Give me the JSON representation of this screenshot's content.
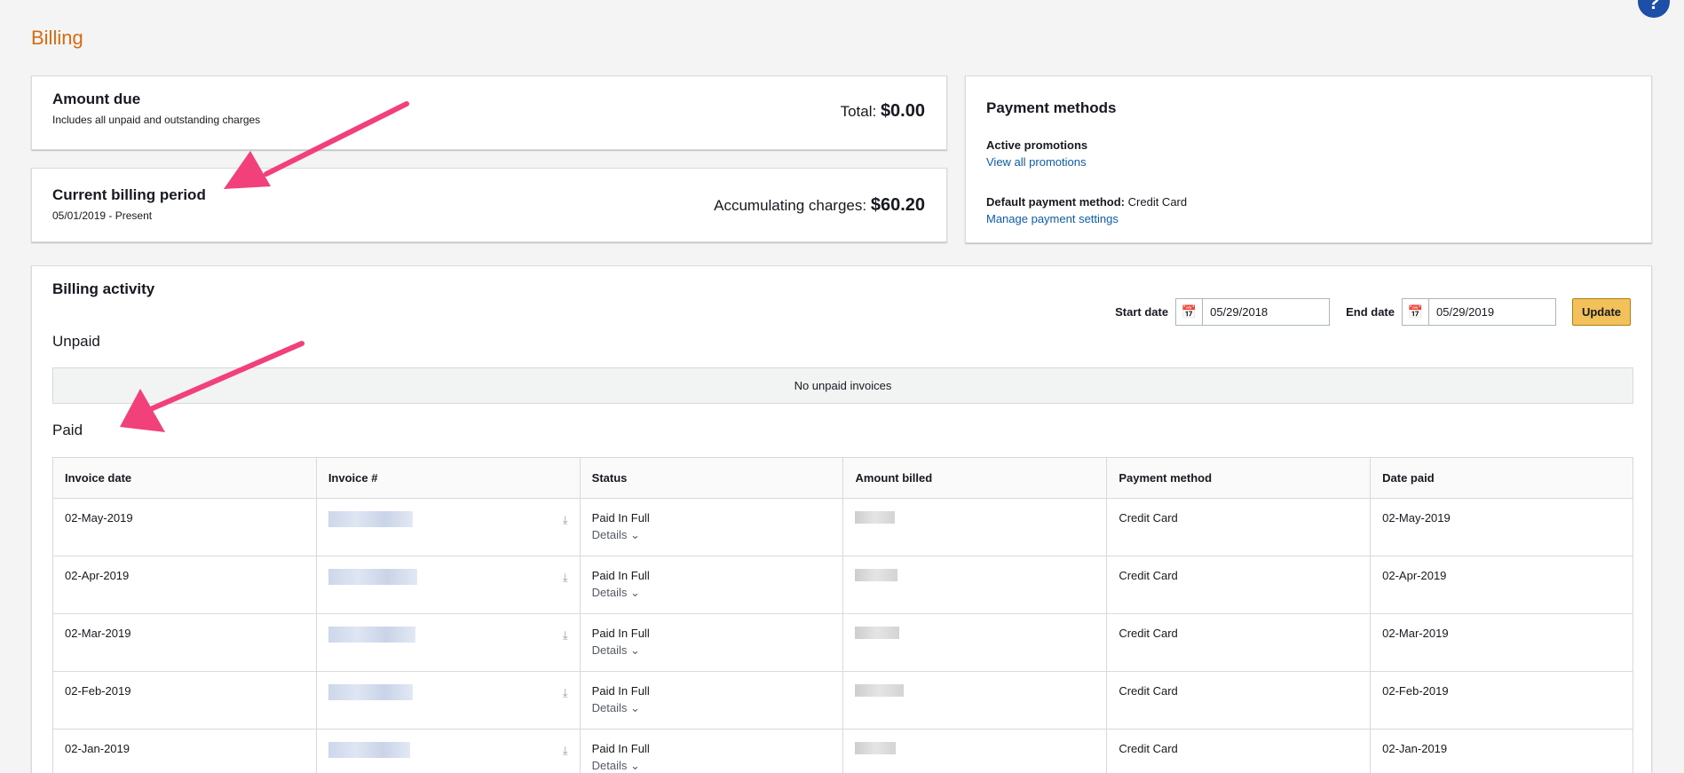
{
  "page": {
    "title": "Billing",
    "help_label": "?"
  },
  "amount_due": {
    "title": "Amount due",
    "subtitle": "Includes all unpaid and outstanding charges",
    "total_label": "Total:",
    "total_value": "$0.00"
  },
  "billing_period": {
    "title": "Current billing period",
    "range": "05/01/2019 - Present",
    "charges_label": "Accumulating charges:",
    "charges_value": "$60.20"
  },
  "payment_methods": {
    "title": "Payment methods",
    "promotions_label": "Active promotions",
    "promotions_link": "View all promotions",
    "default_label": "Default payment method:",
    "default_value": "Credit Card",
    "manage_link": "Manage payment settings"
  },
  "activity": {
    "title": "Billing activity",
    "start_label": "Start date",
    "start_value": "05/29/2018",
    "end_label": "End date",
    "end_value": "05/29/2019",
    "update_label": "Update",
    "unpaid_heading": "Unpaid",
    "no_unpaid": "No unpaid invoices",
    "paid_heading": "Paid",
    "columns": [
      "Invoice date",
      "Invoice #",
      "Status",
      "Amount billed",
      "Payment method",
      "Date paid"
    ],
    "rows": [
      {
        "invoice_date": "02-May-2019",
        "status": "Paid In Full",
        "details": "Details",
        "payment_method": "Credit Card",
        "date_paid": "02-May-2019"
      },
      {
        "invoice_date": "02-Apr-2019",
        "status": "Paid In Full",
        "details": "Details",
        "payment_method": "Credit Card",
        "date_paid": "02-Apr-2019"
      },
      {
        "invoice_date": "02-Mar-2019",
        "status": "Paid In Full",
        "details": "Details",
        "payment_method": "Credit Card",
        "date_paid": "02-Mar-2019"
      },
      {
        "invoice_date": "02-Feb-2019",
        "status": "Paid In Full",
        "details": "Details",
        "payment_method": "Credit Card",
        "date_paid": "02-Feb-2019"
      },
      {
        "invoice_date": "02-Jan-2019",
        "status": "Paid In Full",
        "details": "Details",
        "payment_method": "Credit Card",
        "date_paid": "02-Jan-2019"
      }
    ]
  },
  "colors": {
    "title_orange": "#d66c12",
    "link_blue": "#0a5db3",
    "button_yellow": "#f2c15a",
    "arrow_pink": "#f2407a"
  },
  "icons": {
    "help": "question-circle-icon",
    "calendar": "calendar-icon",
    "download": "download-icon",
    "chevron": "chevron-down-icon"
  }
}
